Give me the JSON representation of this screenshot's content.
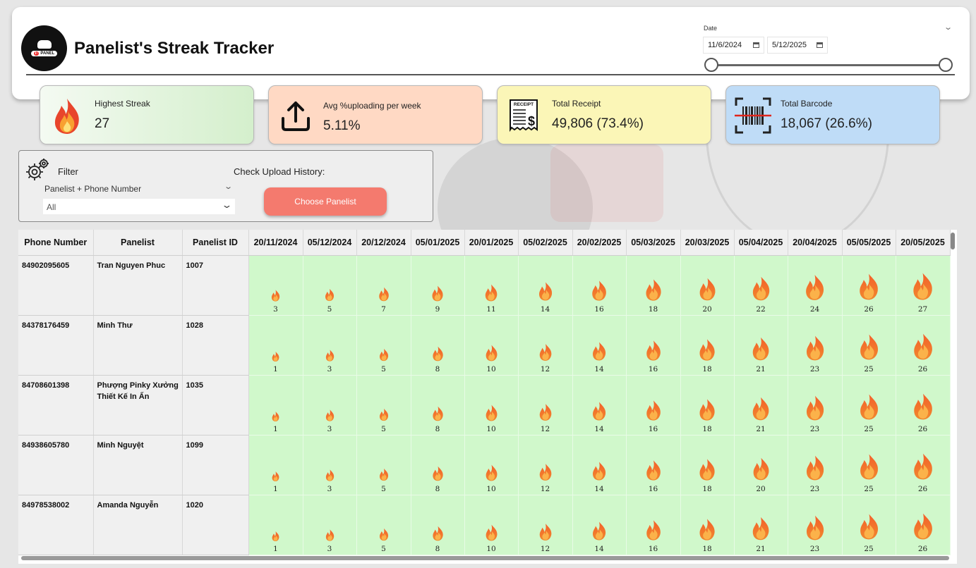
{
  "header": {
    "title": "Panelist's Streak Tracker",
    "logo_text": "PANEL",
    "logo_badge": "i-"
  },
  "date_filter": {
    "label": "Date",
    "from": "11/6/2024",
    "to": "5/12/2025",
    "range_fraction": [
      0,
      1
    ]
  },
  "kpis": [
    {
      "label": "Highest Streak",
      "value": "27",
      "icon": "fire-icon",
      "color": "#d4efcc"
    },
    {
      "label": "Avg %uploading per week",
      "value": "5.11%",
      "icon": "upload-icon",
      "color": "#ffd9c4"
    },
    {
      "label": "Total Receipt",
      "value": "49,806 (73.4%)",
      "icon": "receipt-icon",
      "icon_text": "RECEIPT",
      "color": "#fbf6b7"
    },
    {
      "label": "Total Barcode",
      "value": "18,067 (26.6%)",
      "icon": "barcode-icon",
      "color": "#bfdcf7"
    }
  ],
  "filter": {
    "title": "Filter",
    "field_label": "Panelist + Phone Number",
    "selected": "All",
    "check_label": "Check Upload History:",
    "button_label": "Choose Panelist"
  },
  "table": {
    "columns": [
      "Phone Number",
      "Panelist",
      "Panelist ID"
    ],
    "dates": [
      "20/11/2024",
      "05/12/2024",
      "20/12/2024",
      "05/01/2025",
      "20/01/2025",
      "05/02/2025",
      "20/02/2025",
      "05/03/2025",
      "20/03/2025",
      "05/04/2025",
      "20/04/2025",
      "05/05/2025",
      "20/05/2025"
    ],
    "rows": [
      {
        "phone": "84902095605",
        "name": "Tran Nguyen Phuc",
        "id": "1007",
        "streaks": [
          3,
          5,
          7,
          9,
          11,
          14,
          16,
          18,
          20,
          22,
          24,
          26,
          27
        ]
      },
      {
        "phone": "84378176459",
        "name": "Minh Thư",
        "id": "1028",
        "streaks": [
          1,
          3,
          5,
          8,
          10,
          12,
          14,
          16,
          18,
          21,
          23,
          25,
          26
        ]
      },
      {
        "phone": "84708601398",
        "name": "Phượng Pinky Xưởng Thiết Kế In Ấn",
        "id": "1035",
        "streaks": [
          1,
          3,
          5,
          8,
          10,
          12,
          14,
          16,
          18,
          21,
          23,
          25,
          26
        ]
      },
      {
        "phone": "84938605780",
        "name": "Minh Nguyệt",
        "id": "1099",
        "streaks": [
          1,
          3,
          5,
          8,
          10,
          12,
          14,
          16,
          18,
          20,
          23,
          25,
          26
        ]
      },
      {
        "phone": "84978538002",
        "name": "Amanda Nguyễn",
        "id": "1020",
        "streaks": [
          1,
          3,
          5,
          8,
          10,
          12,
          14,
          16,
          18,
          21,
          23,
          25,
          26
        ]
      }
    ],
    "streak_cell_color": "#d0f8cb"
  }
}
